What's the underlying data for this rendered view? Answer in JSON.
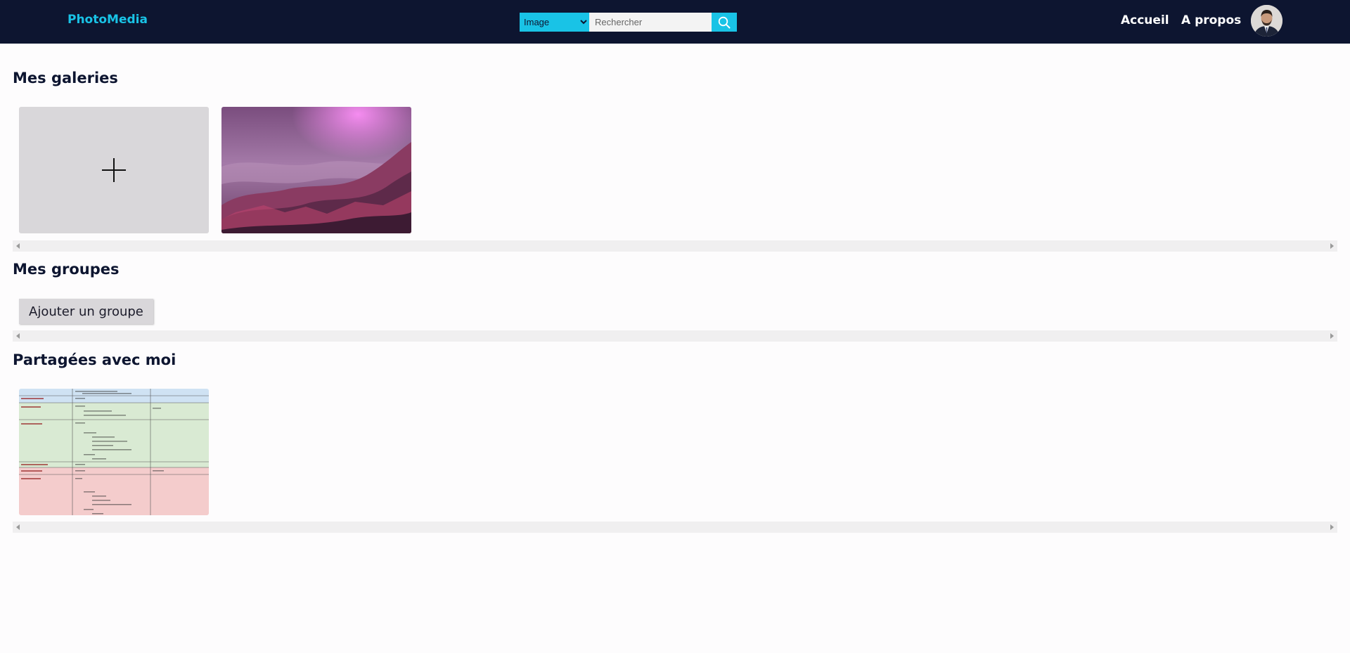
{
  "header": {
    "brand": "PhotoMedia",
    "search_type_selected": "Image",
    "search_type_options": [
      "Image"
    ],
    "search_placeholder": "Rechercher",
    "search_icon": "search-icon",
    "nav_home": "Accueil",
    "nav_about": "A propos",
    "avatar_icon": "user-avatar"
  },
  "galleries": {
    "title": "Mes galeries",
    "add_icon": "plus-icon"
  },
  "groups": {
    "title": "Mes groupes",
    "add_button": "Ajouter un groupe"
  },
  "shared": {
    "title": "Partagées avec moi"
  },
  "colors": {
    "header_bg": "#0d1530",
    "accent": "#19c3e6",
    "card_bg": "#d9d7da"
  }
}
